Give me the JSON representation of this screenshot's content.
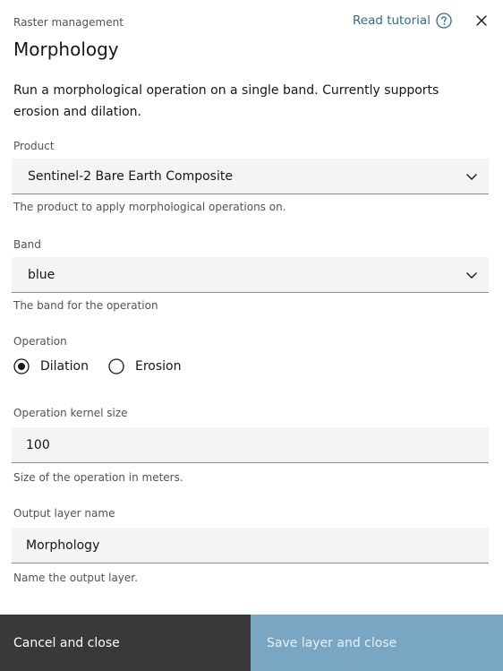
{
  "header": {
    "eyebrow": "Raster management",
    "title": "Morphology",
    "tutorial_label": "Read tutorial"
  },
  "description": "Run a morphological operation on a single band. Currently supports erosion and dilation.",
  "product": {
    "label": "Product",
    "value": "Sentinel-2 Bare Earth Composite",
    "helper": "The product to apply morphological operations on."
  },
  "band": {
    "label": "Band",
    "value": "blue",
    "helper": "The band for the operation"
  },
  "operation": {
    "label": "Operation",
    "options": [
      {
        "label": "Dilation",
        "selected": true
      },
      {
        "label": "Erosion",
        "selected": false
      }
    ]
  },
  "kernel": {
    "label": "Operation kernel size",
    "value": "100",
    "helper": "Size of the operation in meters."
  },
  "output": {
    "label": "Output layer name",
    "value": "Morphology",
    "helper": "Name the output layer."
  },
  "footer": {
    "cancel_label": "Cancel and close",
    "save_label": "Save layer and close"
  },
  "colors": {
    "link": "#2c6e7a",
    "footer_cancel": "#393939",
    "footer_save": "#78a6c3",
    "field_bg": "#f4f4f4"
  }
}
